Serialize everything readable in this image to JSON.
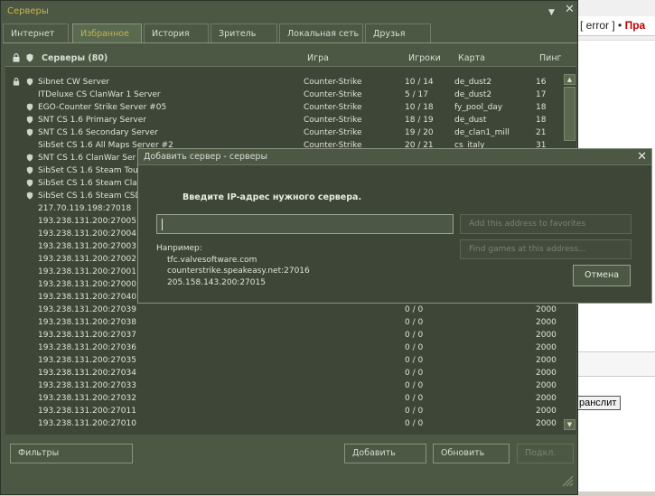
{
  "browser": {
    "error_text": "[ error ]",
    "pr_text": "Пра",
    "translit_label": "ранслит"
  },
  "window": {
    "title": "Серверы",
    "minimize_glyph": "▼",
    "close_glyph": "✕"
  },
  "tabs": [
    {
      "label": "Интернет"
    },
    {
      "label": "Избранное"
    },
    {
      "label": "История"
    },
    {
      "label": "Зритель"
    },
    {
      "label": "Локальная сеть"
    },
    {
      "label": "Друзья"
    }
  ],
  "columns": {
    "servers": "Серверы (80)",
    "game": "Игра",
    "players": "Игроки",
    "map": "Карта",
    "ping": "Пинг"
  },
  "servers": [
    {
      "name": "Sibnet CW Server",
      "game": "Counter-Strike",
      "players": "10 / 14",
      "map": "de_dust2",
      "ping": "16",
      "lock": true,
      "secure": true
    },
    {
      "name": "ITDeluxe CS ClanWar 1 Server",
      "game": "Counter-Strike",
      "players": "5 / 17",
      "map": "de_dust2",
      "ping": "17",
      "lock": false,
      "secure": false
    },
    {
      "name": "EGO-Counter Strike Server #05",
      "game": "Counter-Strike",
      "players": "10 / 18",
      "map": "fy_pool_day",
      "ping": "18",
      "lock": false,
      "secure": true
    },
    {
      "name": "SNT CS 1.6 Primary Server",
      "game": "Counter-Strike",
      "players": "18 / 19",
      "map": "de_dust",
      "ping": "18",
      "lock": false,
      "secure": true
    },
    {
      "name": "SNT CS 1.6 Secondary Server",
      "game": "Counter-Strike",
      "players": "19 / 20",
      "map": "de_clan1_mill",
      "ping": "21",
      "lock": false,
      "secure": true
    },
    {
      "name": "SibSet CS 1.6 All Maps Server #2",
      "game": "Counter-Strike",
      "players": "20 / 21",
      "map": "cs_italy",
      "ping": "31",
      "lock": false,
      "secure": false
    },
    {
      "name": "SNT CS 1.6 ClanWar Ser",
      "game": "",
      "players": "",
      "map": "",
      "ping": "",
      "lock": false,
      "secure": true
    },
    {
      "name": "SibSet CS 1.6 Steam Tou",
      "game": "",
      "players": "",
      "map": "",
      "ping": "",
      "lock": false,
      "secure": true
    },
    {
      "name": "SibSet CS 1.6 Steam Clan",
      "game": "",
      "players": "",
      "map": "",
      "ping": "",
      "lock": false,
      "secure": true
    },
    {
      "name": "SibSet CS 1.6 Steam CSD",
      "game": "",
      "players": "",
      "map": "",
      "ping": "",
      "lock": false,
      "secure": true
    },
    {
      "name": "217.70.119.198:27018",
      "game": "",
      "players": "",
      "map": "",
      "ping": "",
      "lock": false,
      "secure": false
    },
    {
      "name": "193.238.131.200:27005",
      "game": "",
      "players": "",
      "map": "",
      "ping": "",
      "lock": false,
      "secure": false
    },
    {
      "name": "193.238.131.200:27004",
      "game": "",
      "players": "",
      "map": "",
      "ping": "",
      "lock": false,
      "secure": false
    },
    {
      "name": "193.238.131.200:27003",
      "game": "",
      "players": "",
      "map": "",
      "ping": "",
      "lock": false,
      "secure": false
    },
    {
      "name": "193.238.131.200:27002",
      "game": "",
      "players": "",
      "map": "",
      "ping": "",
      "lock": false,
      "secure": false
    },
    {
      "name": "193.238.131.200:27001",
      "game": "",
      "players": "",
      "map": "",
      "ping": "",
      "lock": false,
      "secure": false
    },
    {
      "name": "193.238.131.200:27000",
      "game": "",
      "players": "",
      "map": "",
      "ping": "",
      "lock": false,
      "secure": false
    },
    {
      "name": "193.238.131.200:27040",
      "game": "",
      "players": "",
      "map": "",
      "ping": "",
      "lock": false,
      "secure": false
    },
    {
      "name": "193.238.131.200:27039",
      "game": "",
      "players": "0 / 0",
      "map": "",
      "ping": "2000",
      "lock": false,
      "secure": false
    },
    {
      "name": "193.238.131.200:27038",
      "game": "",
      "players": "0 / 0",
      "map": "",
      "ping": "2000",
      "lock": false,
      "secure": false
    },
    {
      "name": "193.238.131.200:27037",
      "game": "",
      "players": "0 / 0",
      "map": "",
      "ping": "2000",
      "lock": false,
      "secure": false
    },
    {
      "name": "193.238.131.200:27036",
      "game": "",
      "players": "0 / 0",
      "map": "",
      "ping": "2000",
      "lock": false,
      "secure": false
    },
    {
      "name": "193.238.131.200:27035",
      "game": "",
      "players": "0 / 0",
      "map": "",
      "ping": "2000",
      "lock": false,
      "secure": false
    },
    {
      "name": "193.238.131.200:27034",
      "game": "",
      "players": "0 / 0",
      "map": "",
      "ping": "2000",
      "lock": false,
      "secure": false
    },
    {
      "name": "193.238.131.200:27033",
      "game": "",
      "players": "0 / 0",
      "map": "",
      "ping": "2000",
      "lock": false,
      "secure": false
    },
    {
      "name": "193.238.131.200:27032",
      "game": "",
      "players": "0 / 0",
      "map": "",
      "ping": "2000",
      "lock": false,
      "secure": false
    },
    {
      "name": "193.238.131.200:27011",
      "game": "",
      "players": "0 / 0",
      "map": "",
      "ping": "2000",
      "lock": false,
      "secure": false
    },
    {
      "name": "193.238.131.200:27010",
      "game": "",
      "players": "0 / 0",
      "map": "",
      "ping": "2000",
      "lock": false,
      "secure": false
    }
  ],
  "bottom": {
    "filters": "Фильтры",
    "add": "Добавить",
    "refresh": "Обновить",
    "connect": "Подкл."
  },
  "dialog": {
    "title": "Добавить сервер - серверы",
    "close_glyph": "✕",
    "prompt": "Введите IP-адрес нужного сервера.",
    "ip_value": "",
    "add_favorites": "Add this address to favorites",
    "find_games": "Find games at this address...",
    "example_label": "Например:",
    "examples": [
      "tfc.valvesoftware.com",
      "counterstrike.speakeasy.net:27016",
      "205.158.143.200:27015"
    ],
    "cancel": "Отмена"
  },
  "colors": {
    "window_bg": "#4c5844",
    "list_bg": "#3e4637",
    "accent": "#c4b550",
    "text": "#d8ded3"
  }
}
